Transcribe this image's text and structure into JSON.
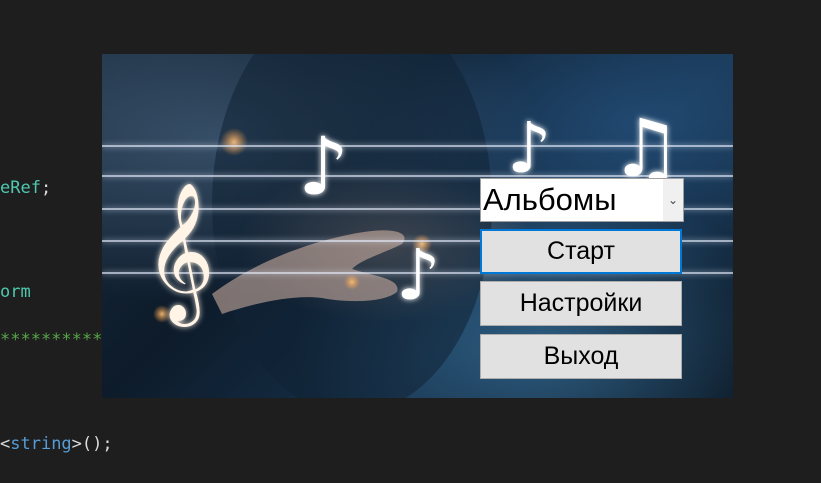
{
  "editor": {
    "line1": "eRef",
    "line1_punct": ";",
    "line2": "orm",
    "line3": "***********",
    "line4_open": "<",
    "line4_type": "string",
    "line4_close": ">();"
  },
  "form": {
    "album_select": {
      "value": "Альбомы",
      "arrow": "⌄"
    },
    "start_label": "Старт",
    "settings_label": "Настройки",
    "exit_label": "Выход"
  },
  "icons": [
    "treble-clef-icon",
    "eighth-note-icon",
    "beamed-notes-icon",
    "chevron-down-icon"
  ]
}
